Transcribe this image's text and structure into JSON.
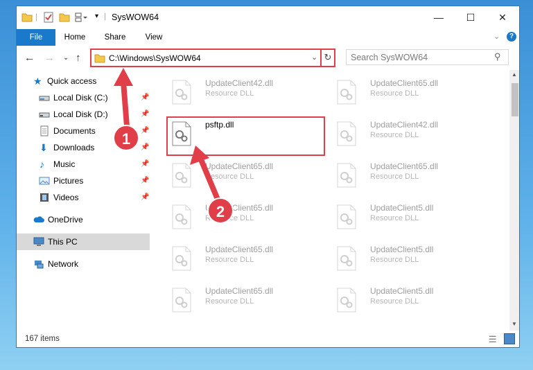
{
  "window": {
    "title": "SysWOW64"
  },
  "ribbon": {
    "tabs": [
      "File",
      "Home",
      "Share",
      "View"
    ]
  },
  "address": {
    "path": "C:\\Windows\\SysWOW64",
    "search_placeholder": "Search SysWOW64"
  },
  "sidebar": {
    "items": [
      {
        "label": "Quick access",
        "icon": "star-icon"
      },
      {
        "label": "Local Disk (C:)",
        "icon": "drive-icon"
      },
      {
        "label": "Local Disk (D:)",
        "icon": "drive-icon"
      },
      {
        "label": "Documents",
        "icon": "documents-icon"
      },
      {
        "label": "Downloads",
        "icon": "downloads-icon"
      },
      {
        "label": "Music",
        "icon": "music-icon"
      },
      {
        "label": "Pictures",
        "icon": "pictures-icon"
      },
      {
        "label": "Videos",
        "icon": "videos-icon"
      },
      {
        "label": "OneDrive",
        "icon": "cloud-icon"
      },
      {
        "label": "This PC",
        "icon": "computer-icon"
      },
      {
        "label": "Network",
        "icon": "network-icon"
      }
    ]
  },
  "files": [
    {
      "name": "UpdateClient42.dll",
      "desc": "Resource DLL"
    },
    {
      "name": "UpdateClient65.dll",
      "desc": "Resource DLL"
    },
    {
      "name": "psftp.dll",
      "desc": ""
    },
    {
      "name": "UpdateClient42.dll",
      "desc": "Resource DLL"
    },
    {
      "name": "UpdateClient65.dll",
      "desc": "Resource DLL"
    },
    {
      "name": "UpdateClient65.dll",
      "desc": "Resource DLL"
    },
    {
      "name": "UpdateClient65.dll",
      "desc": "Resource DLL"
    },
    {
      "name": "UpdateClient5.dll",
      "desc": "Resource DLL"
    },
    {
      "name": "UpdateClient65.dll",
      "desc": "Resource DLL"
    },
    {
      "name": "UpdateClient5.dll",
      "desc": "Resource DLL"
    },
    {
      "name": "UpdateClient65.dll",
      "desc": "Resource DLL"
    },
    {
      "name": "UpdateClient5.dll",
      "desc": "Resource DLL"
    }
  ],
  "status": {
    "count": "167 items"
  },
  "annotations": {
    "step1": "1",
    "step2": "2"
  },
  "colors": {
    "accent": "#1979ca",
    "highlight": "#e03f4a",
    "selected": "#d9d9d9"
  }
}
